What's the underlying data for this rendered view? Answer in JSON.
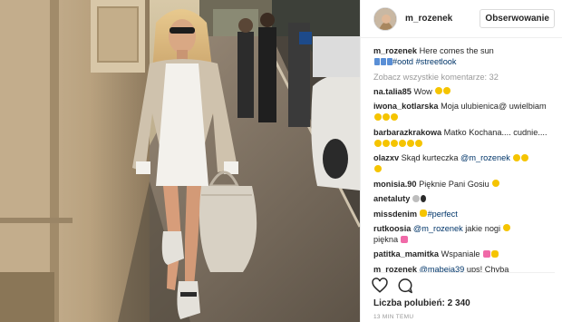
{
  "post": {
    "username": "m_rozenek",
    "follow_label": "Obserwowanie",
    "caption": {
      "user": "m_rozenek",
      "text": "Here comes the sun",
      "hashtags": [
        "#ootd",
        "#streetlook"
      ]
    },
    "view_all_comments": "Zobacz wszystkie komentarze: 32",
    "comments": [
      {
        "user": "na.talia85",
        "text": "Wow"
      },
      {
        "user": "iwona_kotlarska",
        "text": "Moja ulubienica@ uwielbiam"
      },
      {
        "user": "barbarazkrakowa",
        "text": "Matko Kochana.... cudnie...."
      },
      {
        "user": "olazxv",
        "text": "Skąd kurteczka",
        "mention": "@m_rozenek"
      },
      {
        "user": "monisia.90",
        "text": "Pięknie Pani Gosiu"
      },
      {
        "user": "anetaluty",
        "text": ""
      },
      {
        "user": "missdenim",
        "hashtag": "#perfect"
      },
      {
        "user": "rutkoosia",
        "mention": "@m_rozenek",
        "text": "jakie nogi",
        "text2": "piękna"
      },
      {
        "user": "patitka_mamitka",
        "text": "Wspaniale"
      },
      {
        "user": "m_rozenek",
        "mention": "@mabeja39",
        "text": "ups! Chyba"
      }
    ],
    "likes_label": "Liczba polubień: 2 340",
    "time_label": "13 MIN TEMU"
  },
  "icons": {
    "like": "heart-outline-icon",
    "comment": "speech-bubble-icon"
  },
  "colors": {
    "text": "#262626",
    "link": "#003569",
    "muted": "#999999",
    "border": "#efefef"
  }
}
